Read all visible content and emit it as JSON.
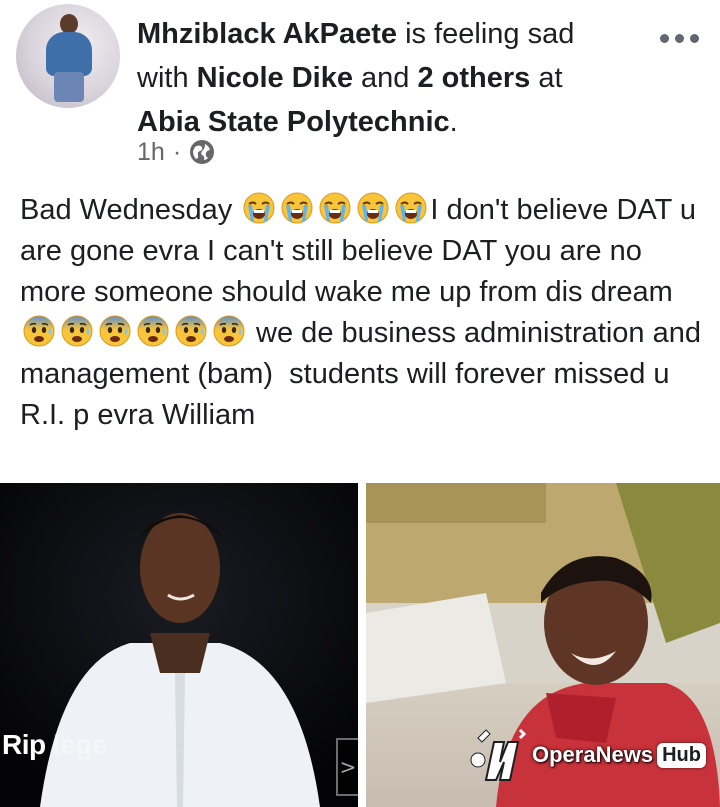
{
  "header": {
    "author": "Mhziblack AkPaete",
    "feeling_text": " is feeling sad",
    "with_word": "with ",
    "tagged_person": "Nicole Dike",
    "and_word": " and ",
    "others_count": "2 others",
    "at_word": " at",
    "location": "Abia State Polytechnic",
    "location_suffix": ".",
    "time": "1h",
    "separator": "·",
    "privacy_icon": "globe-icon",
    "more_icon": "more-options-icon"
  },
  "post": {
    "line1_start": "Bad Wednesday ",
    "crying_emoji_count": 5,
    "line1_end": "I don't believe DAT u are gone evra I can't still believe DAT you are no more someone should wake me up from dis dream ",
    "fearful_emoji_count": 6,
    "line_end": " we de business administration and management (bam)  students will forever missed u R.I. p evra William"
  },
  "photos": {
    "left_caption": "Rip ",
    "left_caption_faded": "lege",
    "nav_arrow": ">",
    "watermark_brand": "OperaNews",
    "watermark_hub": "Hub"
  },
  "colors": {
    "text": "#1c1e21",
    "meta": "#65676b",
    "background": "#ffffff"
  }
}
